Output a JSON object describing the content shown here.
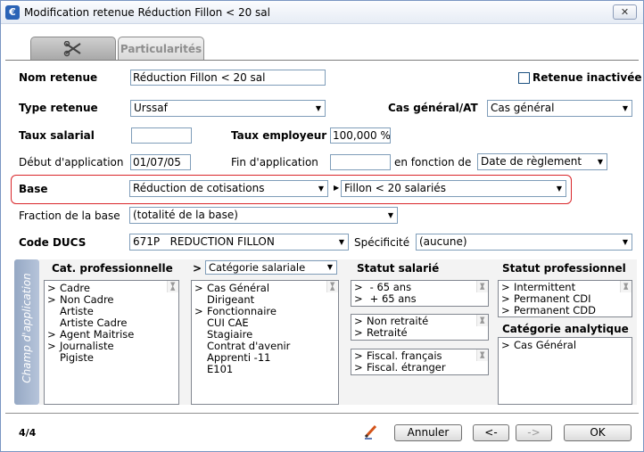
{
  "window": {
    "title": "Modification retenue Réduction Fillon < 20 sal",
    "close": "✕"
  },
  "tabs": {
    "particularites": "Particularités"
  },
  "form": {
    "nom_label": "Nom retenue",
    "nom_value": "Réduction Fillon < 20 sal",
    "inactive_label": "Retenue inactivée",
    "type_label": "Type retenue",
    "type_value": "Urssaf",
    "cas_label": "Cas général/AT",
    "cas_value": "Cas général",
    "taux_sal_label": "Taux salarial",
    "taux_sal_value": "",
    "taux_emp_label": "Taux employeur",
    "taux_emp_value": "100,000 %",
    "debut_label": "Début d'application",
    "debut_value": "01/07/05",
    "fin_label": "Fin d'application",
    "fin_value": "",
    "fonction_label": "en fonction de",
    "fonction_value": "Date de règlement",
    "base_label": "Base",
    "base_value": "Réduction de cotisations",
    "base2_value": "Fillon < 20 salariés",
    "fraction_label": "Fraction de la base",
    "fraction_value": "(totalité de la base)",
    "ducs_label": "Code DUCS",
    "ducs_value": "671P   REDUCTION FILLON",
    "specificite_label": "Spécificité",
    "specificite_value": "(aucune)"
  },
  "champ": {
    "side_label": "Champ d'application",
    "cat_pro_header": "Cat. professionnelle",
    "cat_pro_items": [
      {
        "m": ">",
        "t": "Cadre"
      },
      {
        "m": ">",
        "t": "Non Cadre"
      },
      {
        "m": "",
        "t": "Artiste"
      },
      {
        "m": "",
        "t": "Artiste Cadre"
      },
      {
        "m": ">",
        "t": "Agent Maitrise"
      },
      {
        "m": ">",
        "t": "Journaliste"
      },
      {
        "m": "",
        "t": "Pigiste"
      }
    ],
    "cat_sal_arrow": ">",
    "cat_sal_select": "Catégorie salariale",
    "cat_sal_items": [
      {
        "m": ">",
        "t": "Cas Général"
      },
      {
        "m": "",
        "t": "Dirigeant"
      },
      {
        "m": ">",
        "t": "Fonctionnaire"
      },
      {
        "m": "",
        "t": "CUI CAE"
      },
      {
        "m": "",
        "t": "Stagiaire"
      },
      {
        "m": "",
        "t": "Contrat d'avenir"
      },
      {
        "m": "",
        "t": "Apprenti -11"
      },
      {
        "m": "",
        "t": "E101"
      }
    ],
    "statut_sal_header": "Statut salarié",
    "age_items": [
      {
        "m": ">",
        "t": " - 65 ans"
      },
      {
        "m": ">",
        "t": " + 65 ans"
      }
    ],
    "retraite_items": [
      {
        "m": ">",
        "t": "Non retraité"
      },
      {
        "m": ">",
        "t": "Retraité"
      }
    ],
    "fiscal_items": [
      {
        "m": ">",
        "t": "Fiscal. français"
      },
      {
        "m": ">",
        "t": "Fiscal. étranger"
      }
    ],
    "statut_pro_header": "Statut professionnel",
    "statut_pro_items": [
      {
        "m": ">",
        "t": "Intermittent"
      },
      {
        "m": ">",
        "t": "Permanent CDI"
      },
      {
        "m": ">",
        "t": "Permanent CDD"
      }
    ],
    "analytique_header": "Catégorie analytique",
    "analytique_items": [
      {
        "m": ">",
        "t": "Cas Général"
      }
    ]
  },
  "footer": {
    "counter": "4/4",
    "annuler": "Annuler",
    "prev": "<-",
    "next": "->",
    "ok": "OK"
  }
}
